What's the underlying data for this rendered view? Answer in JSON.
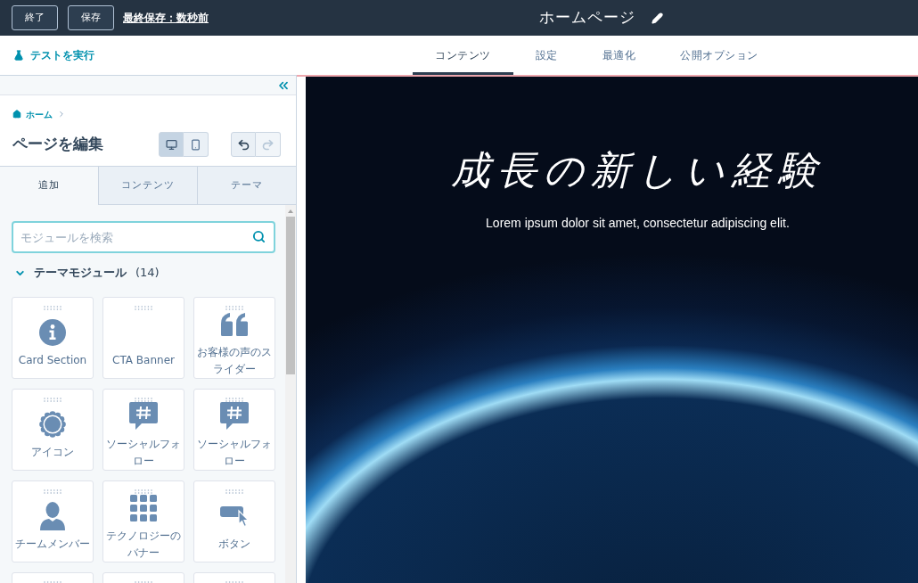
{
  "top_bar": {
    "buttons": [
      "終了",
      "保存"
    ],
    "last_saved": "最終保存：数秒前",
    "page_title": "ホームページ"
  },
  "toolbar": {
    "run_test": "テストを実行",
    "tabs": [
      {
        "label": "コンテンツ",
        "selected": true
      },
      {
        "label": "設定",
        "selected": false
      },
      {
        "label": "最適化",
        "selected": false
      },
      {
        "label": "公開オプション",
        "selected": false
      }
    ]
  },
  "sidebar": {
    "breadcrumb": "ホーム",
    "heading": "ページを編集",
    "devices": [
      {
        "kind": "desktop",
        "selected": true
      },
      {
        "kind": "mobile",
        "selected": false
      }
    ],
    "history": [
      {
        "kind": "undo",
        "disabled": false
      },
      {
        "kind": "redo",
        "disabled": true
      }
    ],
    "tabs": [
      {
        "label": "追加",
        "selected": true
      },
      {
        "label": "コンテンツ",
        "selected": false
      },
      {
        "label": "テーマ",
        "selected": false
      }
    ],
    "search": {
      "placeholder": "モジュールを検索"
    },
    "section": {
      "title": "テーマモジュール",
      "count": "(14)",
      "expanded": true
    },
    "modules": [
      {
        "kind": "info",
        "label": "Card Section"
      },
      {
        "kind": "plain",
        "label": "CTA Banner"
      },
      {
        "kind": "quote",
        "label": "お客様の声のスライダー"
      },
      {
        "kind": "badge",
        "label": "アイコン"
      },
      {
        "kind": "hashtag",
        "label": "ソーシャルフォロー"
      },
      {
        "kind": "hashtag",
        "label": "ソーシャルフォロー"
      },
      {
        "kind": "person",
        "label": "チームメンバー"
      },
      {
        "kind": "grid",
        "label": "テクノロジーのバナー"
      },
      {
        "kind": "button",
        "label": "ボタン"
      },
      {
        "kind": "partial"
      },
      {
        "kind": "partial"
      },
      {
        "kind": "partial"
      }
    ]
  },
  "preview": {
    "heading": "成長の新しい経験",
    "subheading": "Lorem ipsum dolor sit amet, consectetur adipiscing elit."
  }
}
